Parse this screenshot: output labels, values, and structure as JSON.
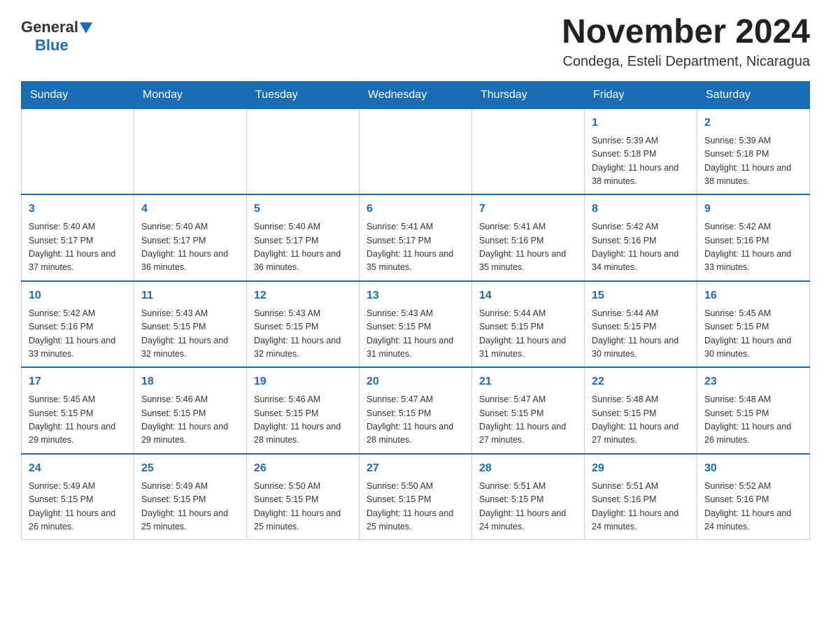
{
  "header": {
    "logo_general": "General",
    "logo_blue": "Blue",
    "title": "November 2024",
    "subtitle": "Condega, Esteli Department, Nicaragua"
  },
  "calendar": {
    "days_of_week": [
      "Sunday",
      "Monday",
      "Tuesday",
      "Wednesday",
      "Thursday",
      "Friday",
      "Saturday"
    ],
    "weeks": [
      [
        {
          "day": "",
          "info": ""
        },
        {
          "day": "",
          "info": ""
        },
        {
          "day": "",
          "info": ""
        },
        {
          "day": "",
          "info": ""
        },
        {
          "day": "",
          "info": ""
        },
        {
          "day": "1",
          "info": "Sunrise: 5:39 AM\nSunset: 5:18 PM\nDaylight: 11 hours and 38 minutes."
        },
        {
          "day": "2",
          "info": "Sunrise: 5:39 AM\nSunset: 5:18 PM\nDaylight: 11 hours and 38 minutes."
        }
      ],
      [
        {
          "day": "3",
          "info": "Sunrise: 5:40 AM\nSunset: 5:17 PM\nDaylight: 11 hours and 37 minutes."
        },
        {
          "day": "4",
          "info": "Sunrise: 5:40 AM\nSunset: 5:17 PM\nDaylight: 11 hours and 36 minutes."
        },
        {
          "day": "5",
          "info": "Sunrise: 5:40 AM\nSunset: 5:17 PM\nDaylight: 11 hours and 36 minutes."
        },
        {
          "day": "6",
          "info": "Sunrise: 5:41 AM\nSunset: 5:17 PM\nDaylight: 11 hours and 35 minutes."
        },
        {
          "day": "7",
          "info": "Sunrise: 5:41 AM\nSunset: 5:16 PM\nDaylight: 11 hours and 35 minutes."
        },
        {
          "day": "8",
          "info": "Sunrise: 5:42 AM\nSunset: 5:16 PM\nDaylight: 11 hours and 34 minutes."
        },
        {
          "day": "9",
          "info": "Sunrise: 5:42 AM\nSunset: 5:16 PM\nDaylight: 11 hours and 33 minutes."
        }
      ],
      [
        {
          "day": "10",
          "info": "Sunrise: 5:42 AM\nSunset: 5:16 PM\nDaylight: 11 hours and 33 minutes."
        },
        {
          "day": "11",
          "info": "Sunrise: 5:43 AM\nSunset: 5:15 PM\nDaylight: 11 hours and 32 minutes."
        },
        {
          "day": "12",
          "info": "Sunrise: 5:43 AM\nSunset: 5:15 PM\nDaylight: 11 hours and 32 minutes."
        },
        {
          "day": "13",
          "info": "Sunrise: 5:43 AM\nSunset: 5:15 PM\nDaylight: 11 hours and 31 minutes."
        },
        {
          "day": "14",
          "info": "Sunrise: 5:44 AM\nSunset: 5:15 PM\nDaylight: 11 hours and 31 minutes."
        },
        {
          "day": "15",
          "info": "Sunrise: 5:44 AM\nSunset: 5:15 PM\nDaylight: 11 hours and 30 minutes."
        },
        {
          "day": "16",
          "info": "Sunrise: 5:45 AM\nSunset: 5:15 PM\nDaylight: 11 hours and 30 minutes."
        }
      ],
      [
        {
          "day": "17",
          "info": "Sunrise: 5:45 AM\nSunset: 5:15 PM\nDaylight: 11 hours and 29 minutes."
        },
        {
          "day": "18",
          "info": "Sunrise: 5:46 AM\nSunset: 5:15 PM\nDaylight: 11 hours and 29 minutes."
        },
        {
          "day": "19",
          "info": "Sunrise: 5:46 AM\nSunset: 5:15 PM\nDaylight: 11 hours and 28 minutes."
        },
        {
          "day": "20",
          "info": "Sunrise: 5:47 AM\nSunset: 5:15 PM\nDaylight: 11 hours and 28 minutes."
        },
        {
          "day": "21",
          "info": "Sunrise: 5:47 AM\nSunset: 5:15 PM\nDaylight: 11 hours and 27 minutes."
        },
        {
          "day": "22",
          "info": "Sunrise: 5:48 AM\nSunset: 5:15 PM\nDaylight: 11 hours and 27 minutes."
        },
        {
          "day": "23",
          "info": "Sunrise: 5:48 AM\nSunset: 5:15 PM\nDaylight: 11 hours and 26 minutes."
        }
      ],
      [
        {
          "day": "24",
          "info": "Sunrise: 5:49 AM\nSunset: 5:15 PM\nDaylight: 11 hours and 26 minutes."
        },
        {
          "day": "25",
          "info": "Sunrise: 5:49 AM\nSunset: 5:15 PM\nDaylight: 11 hours and 25 minutes."
        },
        {
          "day": "26",
          "info": "Sunrise: 5:50 AM\nSunset: 5:15 PM\nDaylight: 11 hours and 25 minutes."
        },
        {
          "day": "27",
          "info": "Sunrise: 5:50 AM\nSunset: 5:15 PM\nDaylight: 11 hours and 25 minutes."
        },
        {
          "day": "28",
          "info": "Sunrise: 5:51 AM\nSunset: 5:15 PM\nDaylight: 11 hours and 24 minutes."
        },
        {
          "day": "29",
          "info": "Sunrise: 5:51 AM\nSunset: 5:16 PM\nDaylight: 11 hours and 24 minutes."
        },
        {
          "day": "30",
          "info": "Sunrise: 5:52 AM\nSunset: 5:16 PM\nDaylight: 11 hours and 24 minutes."
        }
      ]
    ]
  }
}
